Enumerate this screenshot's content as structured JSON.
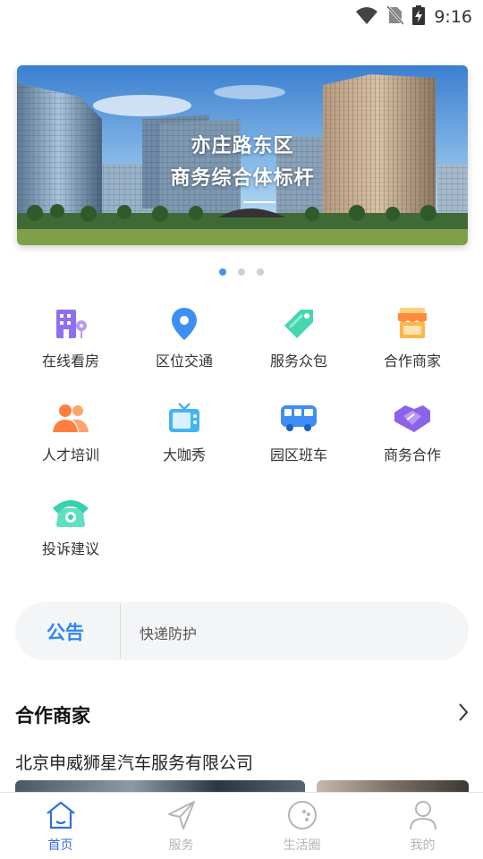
{
  "status_bar": {
    "time": "9:16"
  },
  "banner": {
    "line1": "亦庄路东区",
    "line2": "商务综合体标杆",
    "slide_count": 3,
    "active_slide": 1
  },
  "grid": [
    {
      "label": "在线看房",
      "icon": "building-location-icon"
    },
    {
      "label": "区位交通",
      "icon": "map-pin-icon"
    },
    {
      "label": "服务众包",
      "icon": "tag-icon"
    },
    {
      "label": "合作商家",
      "icon": "store-icon"
    },
    {
      "label": "人才培训",
      "icon": "people-icon"
    },
    {
      "label": "大咖秀",
      "icon": "tv-icon"
    },
    {
      "label": "园区班车",
      "icon": "bus-icon"
    },
    {
      "label": "商务合作",
      "icon": "handshake-icon"
    },
    {
      "label": "投诉建议",
      "icon": "telephone-icon"
    }
  ],
  "notice": {
    "title": "公告",
    "text": "快递防护"
  },
  "partners": {
    "title": "合作商家",
    "company": "北京申威狮星汽车服务有限公司"
  },
  "nav": [
    {
      "label": "首页",
      "icon": "home-icon",
      "active": true
    },
    {
      "label": "服务",
      "icon": "send-icon",
      "active": false
    },
    {
      "label": "生活圈",
      "icon": "life-circle-icon",
      "active": false
    },
    {
      "label": "我的",
      "icon": "user-icon",
      "active": false
    }
  ],
  "colors": {
    "accent": "#2f86ee",
    "nav_active": "#2f6fe0",
    "nav_inactive": "#b5b5b5",
    "dot_active": "#4a8ef0"
  }
}
